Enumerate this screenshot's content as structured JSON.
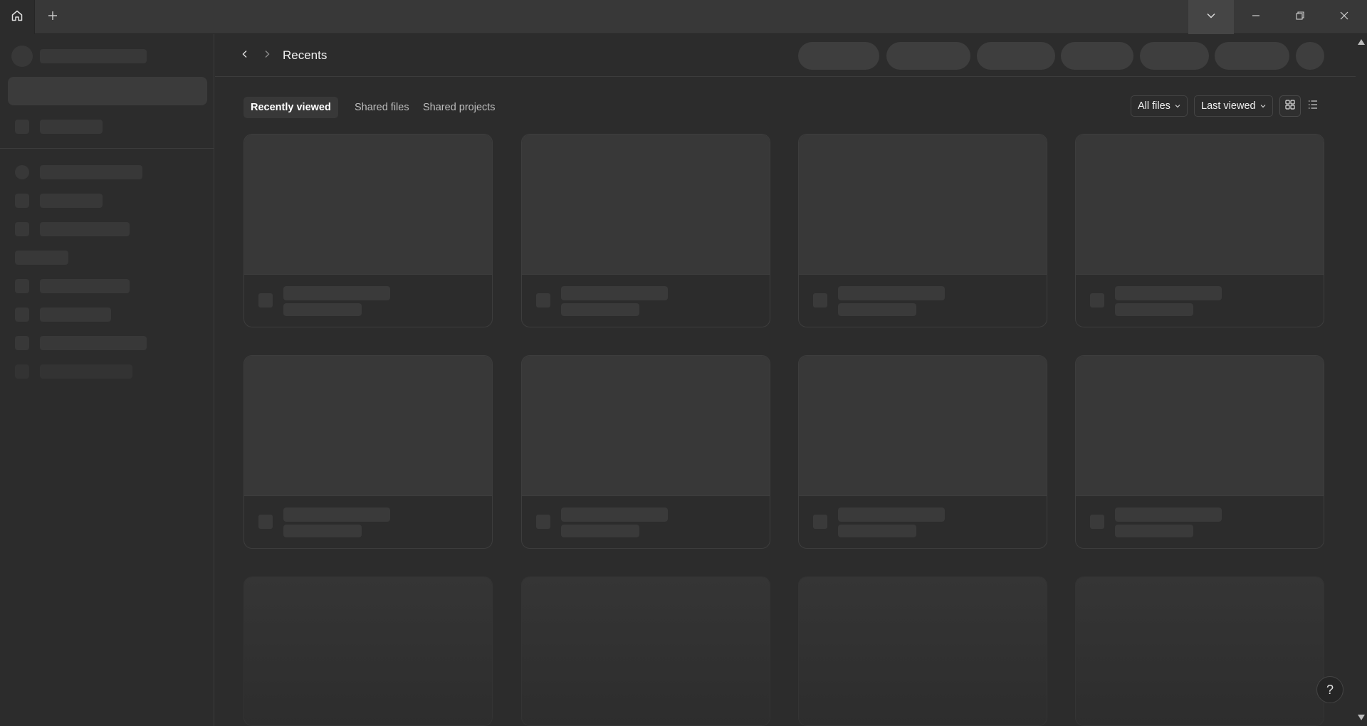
{
  "titlebar": {
    "home_icon": "home-icon",
    "new_tab_icon": "plus-icon",
    "dropdown_icon": "chevron-down-icon",
    "minimize_icon": "minimize-icon",
    "restore_icon": "restore-icon",
    "close_icon": "close-icon"
  },
  "header": {
    "title": "Recents"
  },
  "tabs": [
    {
      "label": "Recently viewed",
      "active": true
    },
    {
      "label": "Shared files",
      "active": false
    },
    {
      "label": "Shared projects",
      "active": false
    }
  ],
  "filters": {
    "file_filter": "All files",
    "sort": "Last viewed"
  },
  "view_modes": [
    "grid-view-icon",
    "list-view-icon"
  ],
  "help_label": "?",
  "colors": {
    "background": "#2c2c2c",
    "titlebar": "#383838",
    "placeholder": "#383838",
    "text": "#f0f0f0"
  }
}
